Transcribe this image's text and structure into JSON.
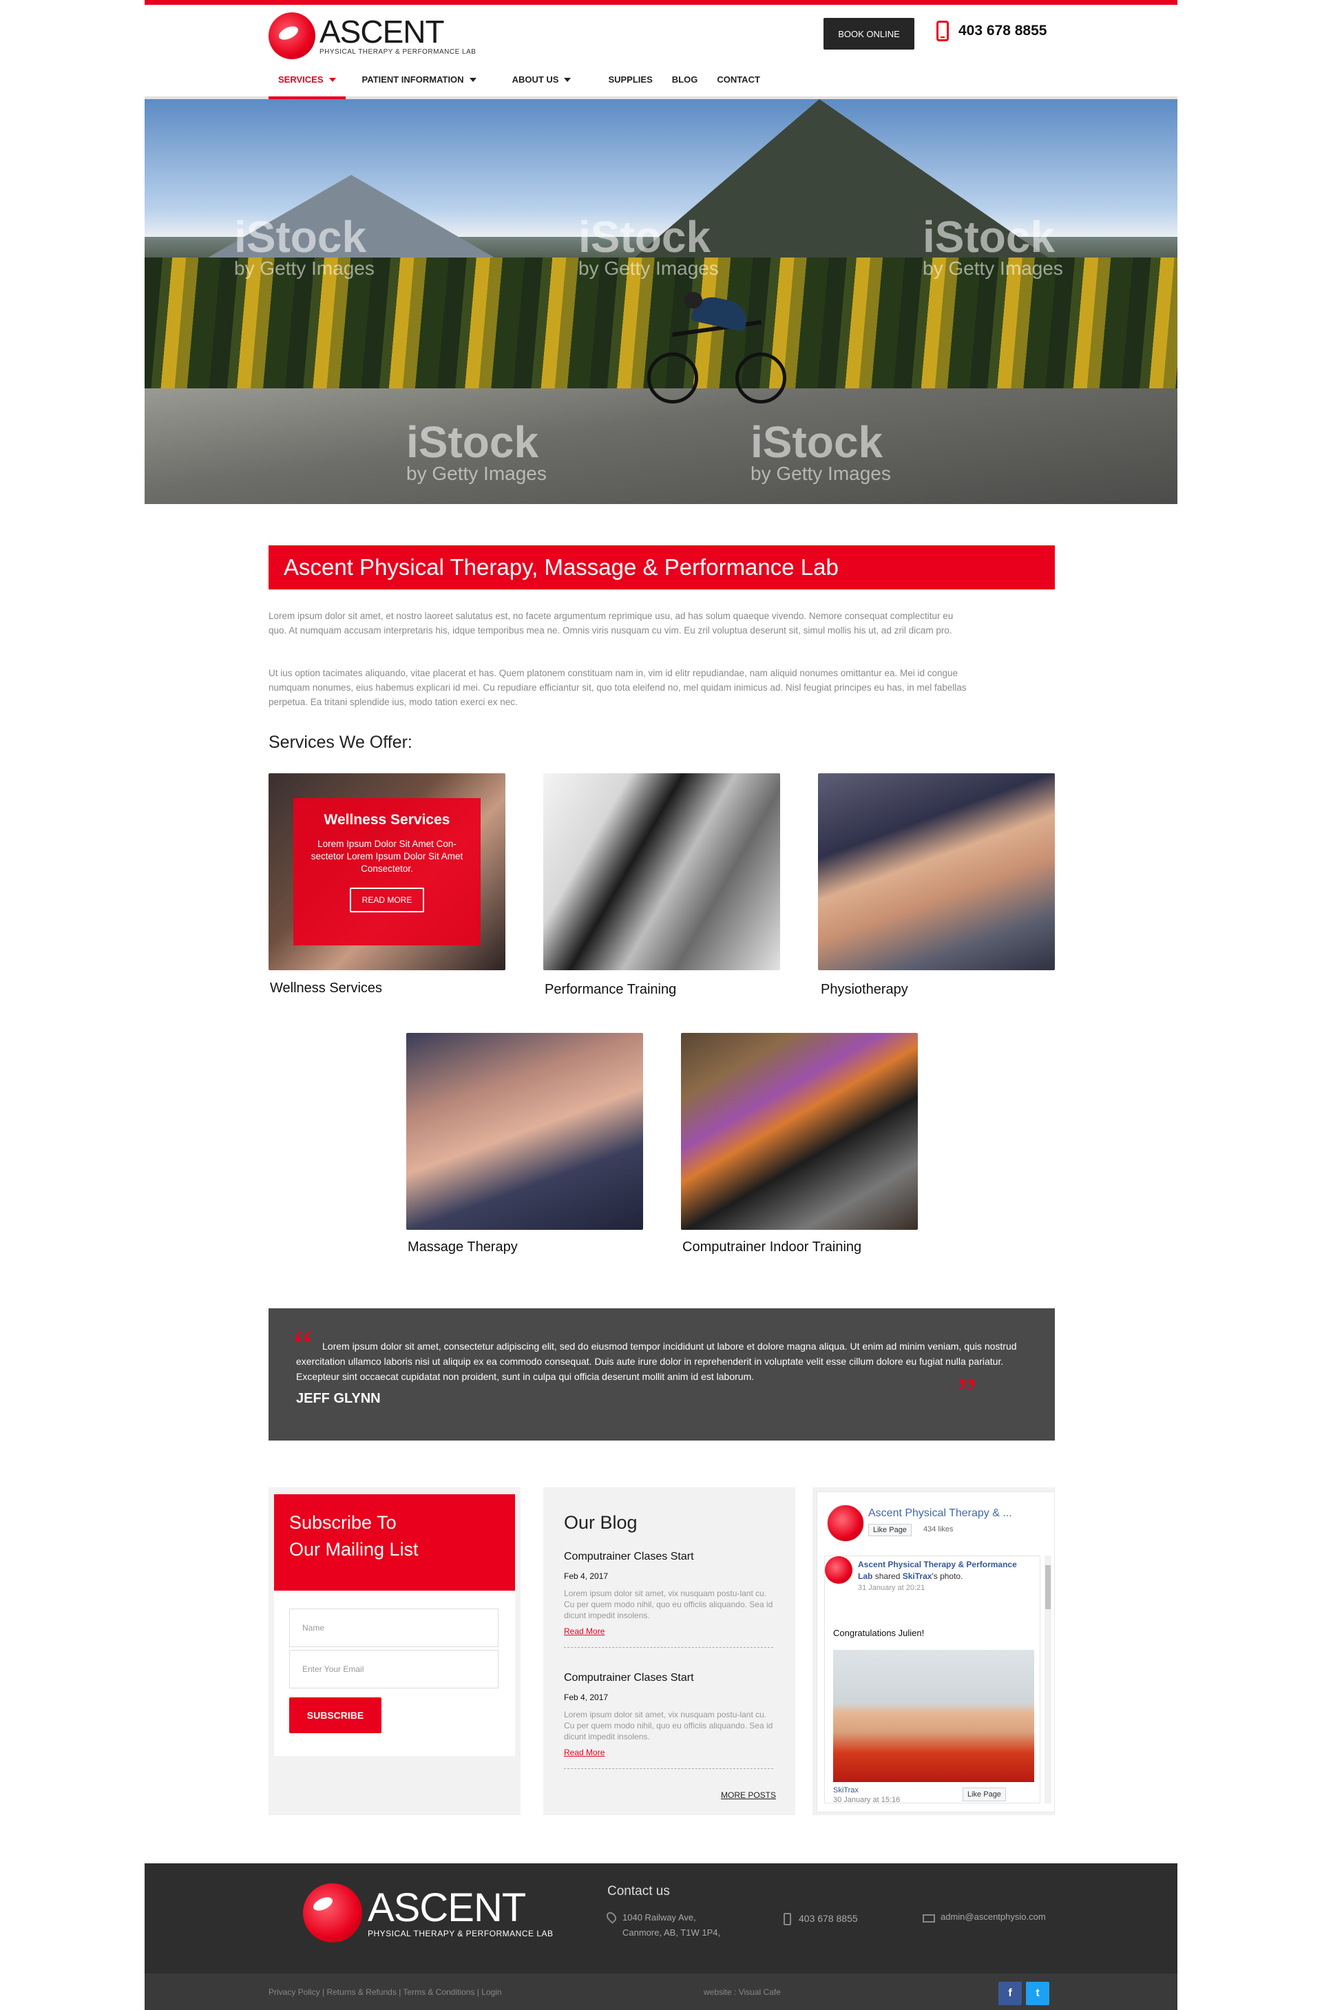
{
  "header": {
    "logo_name": "ASCENT",
    "logo_sub": "PHYSICAL THERAPY & PERFORMANCE LAB",
    "book_label": "BOOK ONLINE",
    "phone": "403 678 8855"
  },
  "nav": {
    "items": [
      {
        "label": "SERVICES",
        "dropdown": true,
        "active": true
      },
      {
        "label": "PATIENT INFORMATION",
        "dropdown": true,
        "active": false
      },
      {
        "label": "ABOUT US",
        "dropdown": true,
        "active": false
      },
      {
        "label": "SUPPLIES",
        "dropdown": false,
        "active": false
      },
      {
        "label": "BLOG",
        "dropdown": false,
        "active": false
      },
      {
        "label": "CONTACT",
        "dropdown": false,
        "active": false
      }
    ]
  },
  "hero": {
    "watermark_main": "iStock",
    "watermark_sub": "by Getty Images"
  },
  "intro": {
    "title": "Ascent Physical Therapy, Massage & Performance Lab",
    "para1": "Lorem ipsum dolor sit amet, et nostro laoreet salutatus est, no facete argumentum reprimique usu, ad has solum quaeque vivendo. Nemore consequat complectitur eu quo. At numquam accusam interpretaris his, idque temporibus mea ne. Omnis viris nusquam cu vim. Eu zril voluptua deserunt sit, simul mollis his ut, ad zril dicam pro.",
    "para2": "Ut ius option tacimates aliquando, vitae placerat et has. Quem platonem constituam nam in, vim id elitr repudiandae, nam aliquid nonumes omittantur ea. Mei id congue numquam nonumes, eius habemus explicari id mei. Cu repudiare efficiantur sit, quo tota eleifend no, mel quidam inimicus ad. Nisl feugiat principes eu has, in mel fabellas perpetua. Ea tritani splendide ius, modo tation exerci ex nec."
  },
  "services": {
    "heading": "Services We Offer:",
    "items": [
      {
        "label": "Wellness Services"
      },
      {
        "label": "Performance Training"
      },
      {
        "label": "Physiotherapy"
      },
      {
        "label": "Massage Therapy"
      },
      {
        "label": "Computrainer Indoor Training"
      }
    ],
    "overlay": {
      "title": "Wellness Services",
      "text": "Lorem Ipsum Dolor Sit Amet Con-sectetor Lorem Ipsum Dolor Sit Amet Consectetor.",
      "button": "READ MORE"
    }
  },
  "testimonial": {
    "quote_open": "“",
    "quote_close": "”",
    "text": "Lorem ipsum dolor sit amet, consectetur adipiscing elit, sed do eiusmod tempor incididunt ut labore et dolore magna aliqua. Ut enim ad minim veniam, quis nostrud exercitation ullamco laboris nisi ut aliquip ex ea commodo consequat. Duis aute irure dolor in reprehenderit in voluptate velit esse cillum dolore eu fugiat nulla pariatur. Excepteur sint occaecat cupidatat non proident, sunt in culpa qui officia deserunt mollit anim id est laborum.",
    "author": "JEFF GLYNN"
  },
  "subscribe": {
    "title_line1": "Subscribe To",
    "title_line2": "Our Mailing List",
    "name_placeholder": "Name",
    "email_placeholder": "Enter Your Email",
    "button": "SUBSCRIBE"
  },
  "blog": {
    "heading": "Our Blog",
    "posts": [
      {
        "title": "Computrainer Clases Start",
        "date": "Feb 4, 2017",
        "excerpt": "Lorem ipsum dolor sit amet, vix nusquam postu-lant cu. Cu per quem modo nihil, quo eu officiis aliquando. Sea id dicunt impedit insolens.",
        "more": "Read More"
      },
      {
        "title": "Computrainer Clases Start",
        "date": "Feb 4, 2017",
        "excerpt": "Lorem ipsum dolor sit amet, vix nusquam postu-lant cu. Cu per quem modo nihil, quo eu officiis aliquando. Sea id dicunt impedit insolens.",
        "more": "Read More"
      }
    ],
    "more_posts": "MORE POSTS"
  },
  "facebook": {
    "page_name": "Ascent Physical Therapy & ...",
    "like_button": "Like Page",
    "likes": "434 likes",
    "post_author": "Ascent Physical Therapy & Performance Lab",
    "post_action": "shared",
    "post_shared_from": "SkiTrax",
    "post_action_end": "'s photo.",
    "post_date": "31 January at 20:21",
    "post_message": "Congratulations Julien!",
    "photo_source": "SkiTrax",
    "photo_date": "30 January at 15:16",
    "photo_like": "Like Page"
  },
  "footer": {
    "contact_heading": "Contact us",
    "address_line1": "1040 Railway Ave,",
    "address_line2": "Canmore, AB, T1W 1P4,",
    "phone": "403 678 8855",
    "email": "admin@ascentphysio.com",
    "links": "Privacy Policy | Returns & Refunds | Terms & Conditions | Login",
    "credit": "website : Visual Cafe",
    "social": [
      {
        "label": "f",
        "color": "#3b5998"
      },
      {
        "label": "t",
        "color": "#1da1f2"
      }
    ]
  },
  "colors": {
    "accent": "#e8001c",
    "dark": "#2e2e2e",
    "panel": "#4a4a4a"
  }
}
